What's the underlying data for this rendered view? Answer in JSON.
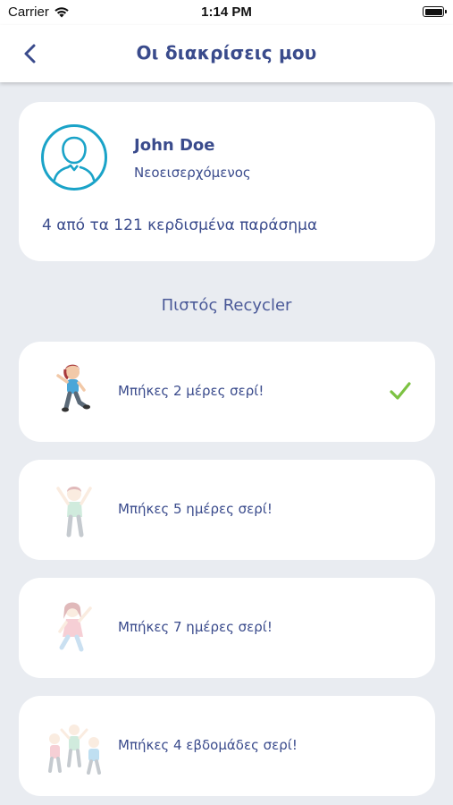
{
  "status_bar": {
    "carrier": "Carrier",
    "time": "1:14 PM"
  },
  "nav": {
    "title": "Οι διακρίσεις μου"
  },
  "profile": {
    "name": "John Doe",
    "rank": "Νεοεισερχόμενος",
    "summary": "4 από τα 121 κερδισμένα παράσημα"
  },
  "section": {
    "title": "Πιστός Recycler"
  },
  "badges": [
    {
      "label": "Μπήκες 2 μέρες σερί!",
      "earned": true
    },
    {
      "label": "Μπήκες 5 ημέρες σερί!",
      "earned": false
    },
    {
      "label": "Μπήκες 7 ημέρες σερί!",
      "earned": false
    },
    {
      "label": "Μπήκες 4 εβδομάδες σερί!",
      "earned": false
    }
  ],
  "colors": {
    "primary": "#3a4b8c",
    "avatar_ring": "#1aa3c8",
    "check": "#7cc242",
    "background": "#e9ecf1"
  }
}
